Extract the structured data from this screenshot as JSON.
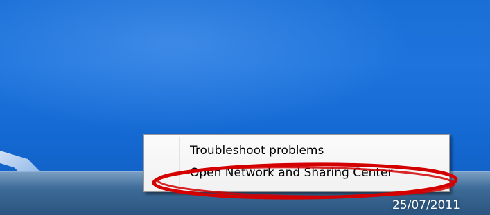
{
  "taskbar": {
    "clock_date": "25/07/2011"
  },
  "context_menu": {
    "items": [
      {
        "label": "Troubleshoot problems"
      },
      {
        "label": "Open Network and Sharing Center"
      }
    ]
  },
  "annotation": {
    "highlight_color": "#d40000",
    "highlighted_item": "Open Network and Sharing Center"
  },
  "colors": {
    "desktop_blue": "#1a6fd6",
    "taskbar": "#3a6894",
    "menu_background": "#f4f4f4"
  }
}
